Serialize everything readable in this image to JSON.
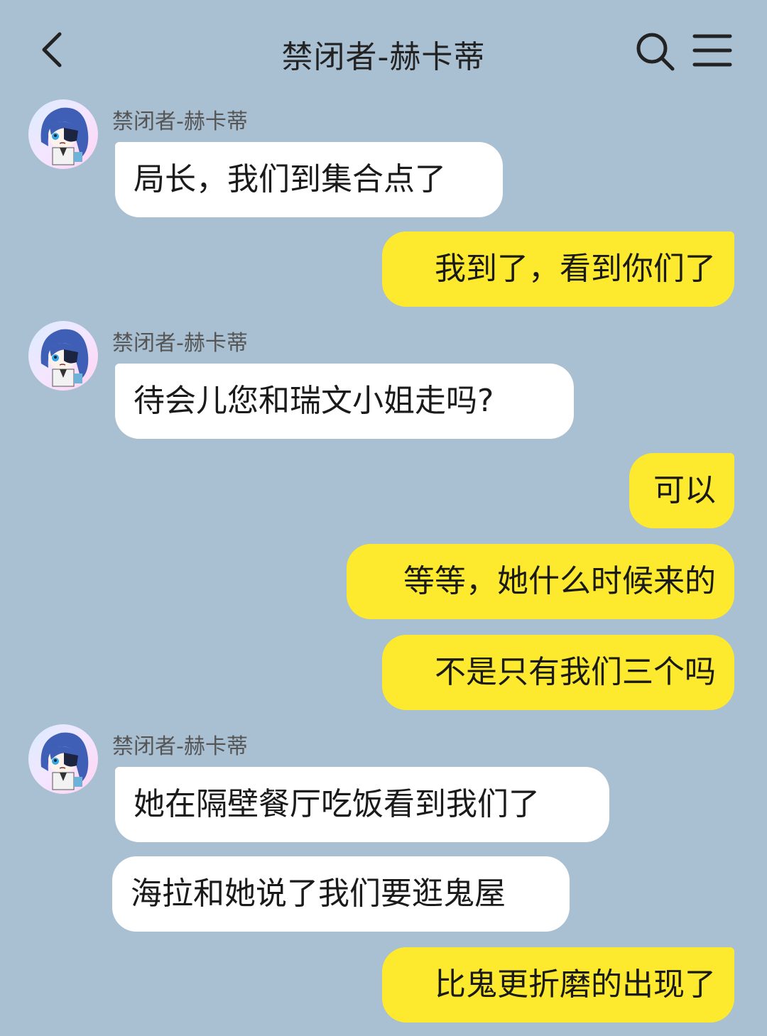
{
  "header": {
    "title": "禁闭者-赫卡蒂"
  },
  "theme": {
    "background": "#a9bfd2",
    "incoming_bubble": "#ffffff",
    "outgoing_bubble": "#fdea2e"
  },
  "icons": {
    "back": "chevron-left-icon",
    "search": "search-icon",
    "menu": "menu-icon",
    "avatar": "avatar"
  },
  "messages": [
    {
      "sender": "禁闭者-赫卡蒂",
      "direction": "in",
      "text": "局长，我们到集合点了"
    },
    {
      "direction": "out",
      "text": "我到了，看到你们了"
    },
    {
      "sender": "禁闭者-赫卡蒂",
      "direction": "in",
      "text": "待会儿您和瑞文小姐走吗?"
    },
    {
      "direction": "out",
      "text": "可以"
    },
    {
      "direction": "out",
      "text": "等等，她什么时候来的"
    },
    {
      "direction": "out",
      "text": "不是只有我们三个吗"
    },
    {
      "sender": "禁闭者-赫卡蒂",
      "direction": "in",
      "text": "她在隔壁餐厅吃饭看到我们了"
    },
    {
      "direction": "in",
      "text": "海拉和她说了我们要逛鬼屋"
    },
    {
      "direction": "out",
      "text": "比鬼更折磨的出现了"
    }
  ]
}
